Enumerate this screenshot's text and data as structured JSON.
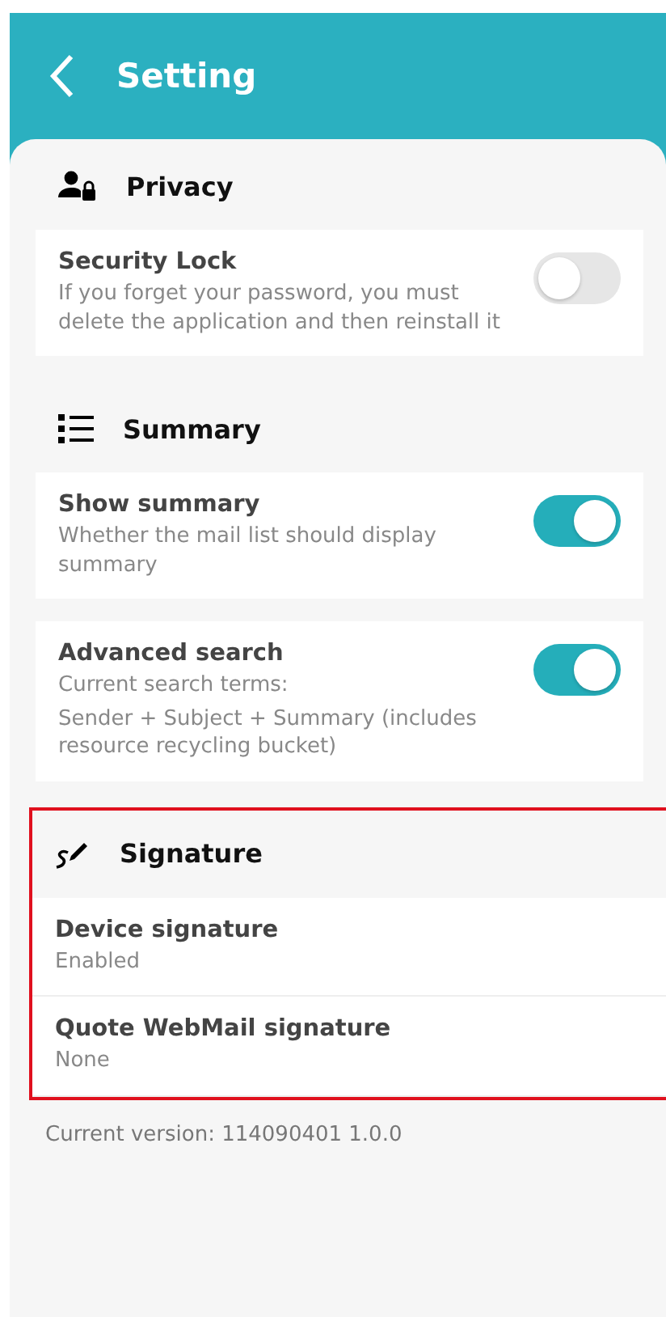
{
  "header": {
    "title": "Setting"
  },
  "sections": [
    {
      "kind": "privacy",
      "title": "Privacy",
      "highlighted": false,
      "rows": [
        {
          "kind": "toggle",
          "title": "Security Lock",
          "lines": [
            "If you forget your password, you must delete the application and then reinstall it"
          ],
          "on": false
        }
      ]
    },
    {
      "kind": "list",
      "title": "Summary",
      "highlighted": false,
      "rows": [
        {
          "kind": "toggle",
          "title": "Show summary",
          "lines": [
            "Whether the mail list should display summary"
          ],
          "on": true
        },
        {
          "kind": "toggle",
          "title": "Advanced search",
          "lines": [
            "Current search terms:",
            "Sender + Subject + Summary (includes resource recycling bucket)"
          ],
          "on": true
        }
      ]
    },
    {
      "kind": "signature",
      "title": "Signature",
      "highlighted": true,
      "rows": [
        {
          "kind": "value",
          "title": "Device signature",
          "lines": [
            "Enabled"
          ]
        },
        {
          "kind": "value",
          "title": "Quote WebMail signature",
          "lines": [
            "None"
          ]
        }
      ]
    }
  ],
  "footer": {
    "version": "Current version:  114090401 1.0.0"
  }
}
